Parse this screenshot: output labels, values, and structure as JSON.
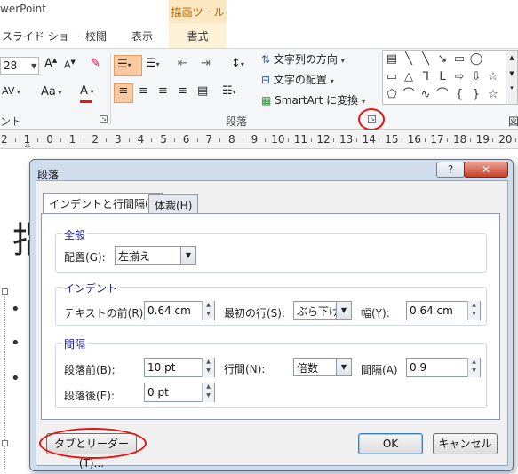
{
  "app": {
    "title": "werPoint",
    "context_tab": "描画ツール"
  },
  "tabs": {
    "slideshow": "スライド ショー",
    "review": "校閲",
    "view": "表示",
    "format": "書式"
  },
  "ribbon": {
    "font_size": "28",
    "grow_font": "A",
    "shrink_font": "A",
    "char_spacing": "AV",
    "change_case": "Aa",
    "font_color_letter": "A",
    "text_direction": "文字列の方向",
    "align_text": "文字の配置",
    "smartart": "SmartArt に変換",
    "group_font_fragment": "ント",
    "group_paragraph": "段落",
    "group_drawing_fragment": "図",
    "accent_red": "#e11a1a"
  },
  "ruler": {
    "numbers": [
      "2",
      "1",
      "0",
      "1",
      "2",
      "3",
      "4",
      "5",
      "6",
      "7",
      "8",
      "9",
      "10",
      "11",
      "12",
      "13",
      "14",
      "15",
      "16",
      "17",
      "18",
      "19",
      "20"
    ]
  },
  "slide": {
    "big_char": "指",
    "bullets": [
      "•",
      "•",
      "•"
    ]
  },
  "dialog": {
    "title": "段落",
    "help": "?",
    "close": "✕",
    "tab_indent": "インデントと行間隔(I)",
    "tab_typography": "体裁(H)",
    "general": {
      "label": "全般",
      "alignment_label": "配置(G):",
      "alignment_value": "左揃え"
    },
    "indent": {
      "label": "インデント",
      "before_text_label": "テキストの前(R):",
      "before_text_value": "0.64 cm",
      "special_label": "最初の行(S):",
      "special_value": "ぶら下げ",
      "by_label": "幅(Y):",
      "by_value": "0.64 cm"
    },
    "spacing": {
      "label": "間隔",
      "before_label": "段落前(B):",
      "before_value": "10 pt",
      "after_label": "段落後(E):",
      "after_value": "0 pt",
      "line_spacing_label": "行間(N):",
      "line_spacing_value": "倍数",
      "at_label": "間隔(A)",
      "at_value": "0.9"
    },
    "tabs_button": "タブとリーダー(T)...",
    "ok": "OK",
    "cancel": "キャンセル"
  }
}
